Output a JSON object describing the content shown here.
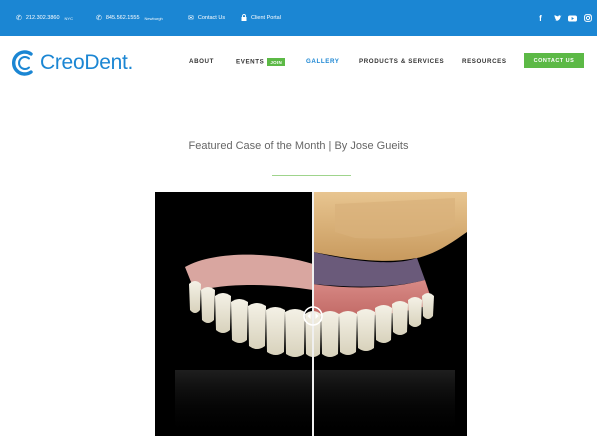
{
  "topbar": {
    "phone_nyc": "212.302.3860",
    "phone_nyc_tag": "NYC",
    "phone_newburgh": "845.562.1555",
    "phone_newburgh_tag": "Newburgh",
    "contact_us": "Contact Us",
    "client_portal": "Client Portal",
    "social_icons": [
      "facebook-icon",
      "twitter-icon",
      "youtube-icon",
      "instagram-icon"
    ]
  },
  "logo": {
    "part1": "Creo",
    "part2": "Dent",
    "part3": "."
  },
  "nav": {
    "items": [
      {
        "label": "ABOUT"
      },
      {
        "label": "EVENTS"
      },
      {
        "label": "GALLERY"
      },
      {
        "label": "PRODUCTS & SERVICES"
      },
      {
        "label": "RESOURCES"
      }
    ],
    "join_badge": "JOIN",
    "contact_button": "CONTACT US",
    "active": "GALLERY"
  },
  "feature": {
    "title": "Featured Case of the Month | By Jose Gueits"
  },
  "colors": {
    "brand_blue": "#1b86d3",
    "accent_green": "#5cb946"
  }
}
